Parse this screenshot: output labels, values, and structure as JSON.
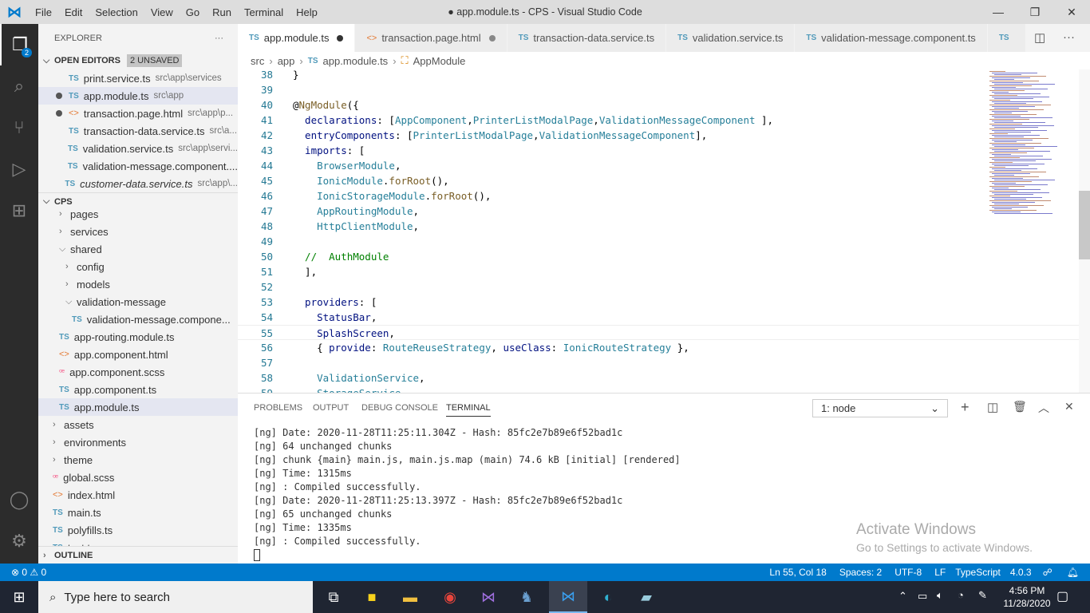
{
  "titlebar": {
    "menu": [
      "File",
      "Edit",
      "Selection",
      "View",
      "Go",
      "Run",
      "Terminal",
      "Help"
    ],
    "title": "● app.module.ts - CPS - Visual Studio Code"
  },
  "activity": {
    "explorer_badge": "2"
  },
  "sidebar": {
    "header": "EXPLORER",
    "more": "···",
    "open_editors": {
      "label": "OPEN EDITORS",
      "badge": "2 UNSAVED",
      "items": [
        {
          "icon": "ts",
          "name": "print.service.ts",
          "path": "src\\app\\services",
          "dirty": false
        },
        {
          "icon": "ts",
          "name": "app.module.ts",
          "path": "src\\app",
          "dirty": true,
          "selected": true
        },
        {
          "icon": "html",
          "name": "transaction.page.html",
          "path": "src\\app\\p...",
          "dirty": true
        },
        {
          "icon": "ts",
          "name": "transaction-data.service.ts",
          "path": "src\\a...",
          "dirty": false
        },
        {
          "icon": "ts",
          "name": "validation.service.ts",
          "path": "src\\app\\servi...",
          "dirty": false
        },
        {
          "icon": "ts",
          "name": "validation-message.component....",
          "path": "",
          "dirty": false
        },
        {
          "icon": "ts",
          "name": "customer-data.service.ts",
          "path": "src\\app\\...",
          "dirty": false,
          "italic": true
        }
      ]
    },
    "project": {
      "label": "CPS",
      "items": [
        {
          "type": "folder",
          "name": "pages",
          "indent": 2,
          "open": false
        },
        {
          "type": "folder",
          "name": "services",
          "indent": 2,
          "open": false
        },
        {
          "type": "folder",
          "name": "shared",
          "indent": 2,
          "open": true
        },
        {
          "type": "folder",
          "name": "config",
          "indent": 3,
          "open": false
        },
        {
          "type": "folder",
          "name": "models",
          "indent": 3,
          "open": false
        },
        {
          "type": "folder",
          "name": "validation-message",
          "indent": 3,
          "open": true
        },
        {
          "type": "ts",
          "name": "validation-message.compone...",
          "indent": 4
        },
        {
          "type": "ts",
          "name": "app-routing.module.ts",
          "indent": 2
        },
        {
          "type": "html",
          "name": "app.component.html",
          "indent": 2
        },
        {
          "type": "scss",
          "name": "app.component.scss",
          "indent": 2
        },
        {
          "type": "ts",
          "name": "app.component.ts",
          "indent": 2
        },
        {
          "type": "ts",
          "name": "app.module.ts",
          "indent": 2,
          "selected": true
        },
        {
          "type": "folder",
          "name": "assets",
          "indent": 1,
          "open": false
        },
        {
          "type": "folder",
          "name": "environments",
          "indent": 1,
          "open": false
        },
        {
          "type": "folder",
          "name": "theme",
          "indent": 1,
          "open": false
        },
        {
          "type": "scss",
          "name": "global.scss",
          "indent": 1
        },
        {
          "type": "html",
          "name": "index.html",
          "indent": 1
        },
        {
          "type": "ts",
          "name": "main.ts",
          "indent": 1
        },
        {
          "type": "ts",
          "name": "polyfills.ts",
          "indent": 1
        },
        {
          "type": "ts",
          "name": "test.ts",
          "indent": 1
        }
      ]
    },
    "outline": "OUTLINE"
  },
  "tabs": [
    {
      "icon": "ts",
      "label": "app.module.ts",
      "dirty": true,
      "active": true
    },
    {
      "icon": "html",
      "label": "transaction.page.html",
      "dirty": true
    },
    {
      "icon": "ts",
      "label": "transaction-data.service.ts"
    },
    {
      "icon": "ts",
      "label": "validation.service.ts"
    },
    {
      "icon": "ts",
      "label": "validation-message.component.ts"
    },
    {
      "icon": "ts",
      "label": "TS"
    }
  ],
  "breadcrumb": [
    "src",
    "app",
    "app.module.ts",
    "AppModule"
  ],
  "editor": {
    "lines": [
      {
        "n": "38",
        "t": [
          [
            "}",
            "p"
          ]
        ]
      },
      {
        "n": "39",
        "t": []
      },
      {
        "n": "40",
        "t": [
          [
            "@",
            "p"
          ],
          [
            "NgModule",
            "f"
          ],
          [
            "({",
            "p"
          ]
        ]
      },
      {
        "n": "41",
        "t": [
          [
            "  declarations",
            "k"
          ],
          [
            ": [",
            "p"
          ],
          [
            "AppComponent",
            "c"
          ],
          [
            ",",
            "p"
          ],
          [
            "PrinterListModalPage",
            "c"
          ],
          [
            ",",
            "p"
          ],
          [
            "ValidationMessageComponent",
            "c"
          ],
          [
            " ],",
            "p"
          ]
        ]
      },
      {
        "n": "42",
        "t": [
          [
            "  entryComponents",
            "k"
          ],
          [
            ": [",
            "p"
          ],
          [
            "PrinterListModalPage",
            "c"
          ],
          [
            ",",
            "p"
          ],
          [
            "ValidationMessageComponent",
            "c"
          ],
          [
            "],",
            "p"
          ]
        ]
      },
      {
        "n": "43",
        "t": [
          [
            "  imports",
            "k"
          ],
          [
            ": [",
            "p"
          ]
        ]
      },
      {
        "n": "44",
        "t": [
          [
            "    BrowserModule",
            "c"
          ],
          [
            ",",
            "p"
          ]
        ]
      },
      {
        "n": "45",
        "t": [
          [
            "    IonicModule",
            "c"
          ],
          [
            ".",
            "p"
          ],
          [
            "forRoot",
            "f"
          ],
          [
            "(),",
            "p"
          ]
        ]
      },
      {
        "n": "46",
        "t": [
          [
            "    IonicStorageModule",
            "c"
          ],
          [
            ".",
            "p"
          ],
          [
            "forRoot",
            "f"
          ],
          [
            "(),",
            "p"
          ]
        ]
      },
      {
        "n": "47",
        "t": [
          [
            "    AppRoutingModule",
            "c"
          ],
          [
            ",",
            "p"
          ]
        ]
      },
      {
        "n": "48",
        "t": [
          [
            "    HttpClientModule",
            "c"
          ],
          [
            ",",
            "p"
          ]
        ]
      },
      {
        "n": "49",
        "t": []
      },
      {
        "n": "50",
        "t": [
          [
            "  //  AuthModule",
            "m"
          ]
        ]
      },
      {
        "n": "51",
        "t": [
          [
            "  ],",
            "p"
          ]
        ]
      },
      {
        "n": "52",
        "t": []
      },
      {
        "n": "53",
        "t": [
          [
            "  providers",
            "k"
          ],
          [
            ": [",
            "p"
          ]
        ]
      },
      {
        "n": "54",
        "t": [
          [
            "    StatusBar",
            "k"
          ],
          [
            ",",
            "p"
          ]
        ]
      },
      {
        "n": "55",
        "t": [
          [
            "    SplashScreen",
            "k"
          ],
          [
            ",",
            "p"
          ]
        ],
        "current": true
      },
      {
        "n": "56",
        "t": [
          [
            "    { ",
            "p"
          ],
          [
            "provide",
            "k"
          ],
          [
            ": ",
            "p"
          ],
          [
            "RouteReuseStrategy",
            "c"
          ],
          [
            ", ",
            "p"
          ],
          [
            "useClass",
            "k"
          ],
          [
            ": ",
            "p"
          ],
          [
            "IonicRouteStrategy",
            "c"
          ],
          [
            " },",
            "p"
          ]
        ]
      },
      {
        "n": "57",
        "t": []
      },
      {
        "n": "58",
        "t": [
          [
            "    ValidationService",
            "c"
          ],
          [
            ",",
            "p"
          ]
        ]
      },
      {
        "n": "59",
        "t": [
          [
            "    StorageService",
            "c"
          ]
        ]
      }
    ]
  },
  "panel": {
    "tabs": [
      "PROBLEMS",
      "OUTPUT",
      "DEBUG CONSOLE",
      "TERMINAL"
    ],
    "active_tab": "TERMINAL",
    "terminal_select": "1: node",
    "terminal_lines": [
      "[ng] Date: 2020-11-28T11:25:11.304Z - Hash: 85fc2e7b89e6f52bad1c",
      "[ng] 64 unchanged chunks",
      "[ng] chunk {main} main.js, main.js.map (main) 74.6 kB [initial] [rendered]",
      "[ng] Time: 1315ms",
      "[ng] : Compiled successfully.",
      "[ng] Date: 2020-11-28T11:25:13.397Z - Hash: 85fc2e7b89e6f52bad1c",
      "[ng] 65 unchanged chunks",
      "[ng] Time: 1335ms",
      "[ng] : Compiled successfully."
    ]
  },
  "watermark": {
    "title": "Activate Windows",
    "subtitle": "Go to Settings to activate Windows."
  },
  "status": {
    "errors": "0",
    "warnings": "0",
    "position": "Ln 55, Col 18",
    "spaces": "Spaces: 2",
    "encoding": "UTF-8",
    "eol": "LF",
    "language": "TypeScript",
    "version": "4.0.3"
  },
  "taskbar": {
    "search_placeholder": "Type here to search",
    "time": "4:56 PM",
    "date": "11/28/2020"
  },
  "colors": {
    "accent": "#007acc",
    "activity_bar": "#2c2c2c",
    "taskbar": "#1f2532"
  }
}
